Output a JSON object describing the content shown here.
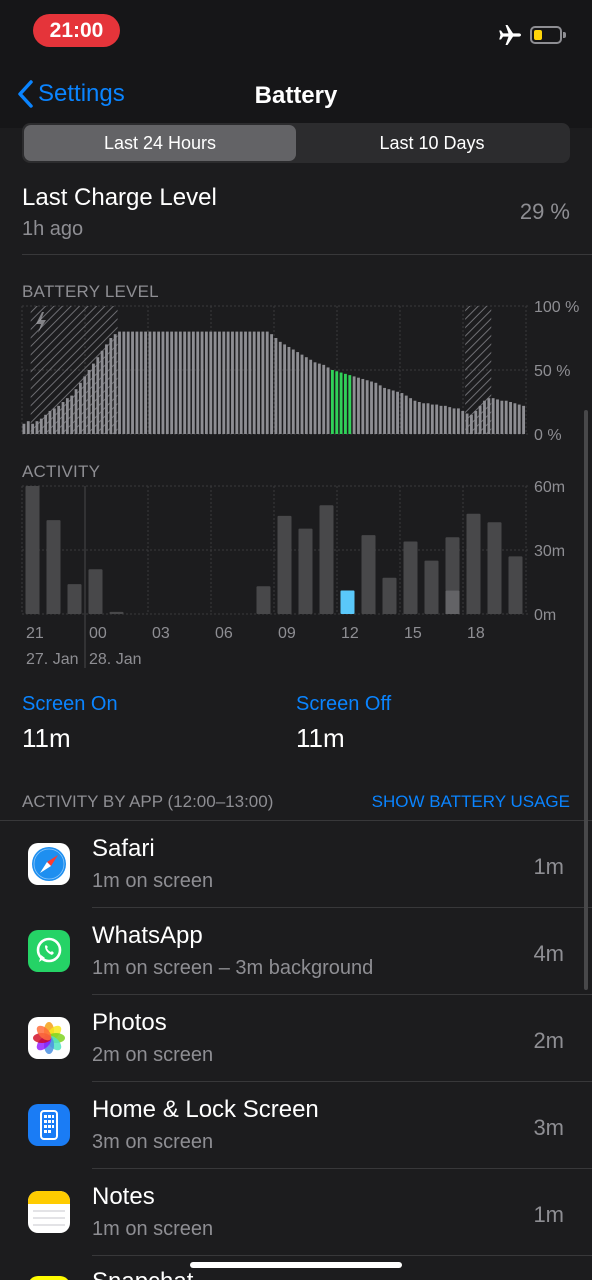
{
  "status": {
    "time": "21:00",
    "airplane_icon": "airplane-icon",
    "battery_icon": "battery-low-icon"
  },
  "nav": {
    "back_label": "Settings",
    "title": "Battery"
  },
  "segments": {
    "active": "Last 24 Hours",
    "inactive": "Last 10 Days"
  },
  "last_charge": {
    "title": "Last Charge Level",
    "sub": "1h ago",
    "value": "29 %"
  },
  "battery_level": {
    "label": "BATTERY LEVEL",
    "y_labels": [
      "100 %",
      "50 %",
      "0 %"
    ]
  },
  "activity": {
    "label": "ACTIVITY",
    "y_labels": [
      "60m",
      "30m",
      "0m"
    ],
    "x_labels": [
      "21",
      "00",
      "03",
      "06",
      "09",
      "12",
      "15",
      "18"
    ],
    "date_labels": [
      "27. Jan",
      "28. Jan"
    ]
  },
  "screen_on": {
    "label": "Screen On",
    "value": "11m"
  },
  "screen_off": {
    "label": "Screen Off",
    "value": "11m"
  },
  "activity_by_app": {
    "label": "ACTIVITY BY APP (12:00–13:00)",
    "link": "SHOW BATTERY USAGE"
  },
  "apps": [
    {
      "name": "Safari",
      "sub": "1m on screen",
      "time": "1m",
      "icon": "safari-icon"
    },
    {
      "name": "WhatsApp",
      "sub": "1m on screen – 3m background",
      "time": "4m",
      "icon": "whatsapp-icon"
    },
    {
      "name": "Photos",
      "sub": "2m on screen",
      "time": "2m",
      "icon": "photos-icon"
    },
    {
      "name": "Home & Lock Screen",
      "sub": "3m on screen",
      "time": "3m",
      "icon": "home-lock-screen-icon"
    },
    {
      "name": "Notes",
      "sub": "1m on screen",
      "time": "1m",
      "icon": "notes-icon"
    },
    {
      "name": "Snapchat",
      "icon": "snapchat-icon"
    }
  ],
  "colors": {
    "accent": "#0a84ff",
    "charging_green": "#30d158",
    "selected_blue": "#0a84ff",
    "selected_light": "#5ac8fa"
  },
  "chart_data": [
    {
      "type": "bar",
      "title": "BATTERY LEVEL",
      "ylim": [
        0,
        100
      ],
      "y_ticks": [
        "100 %",
        "50 %",
        "0 %"
      ],
      "values": [
        8,
        10,
        8,
        10,
        12,
        15,
        18,
        20,
        22,
        25,
        28,
        30,
        35,
        40,
        45,
        50,
        55,
        60,
        65,
        70,
        75,
        78,
        80,
        80,
        80,
        80,
        80,
        80,
        80,
        80,
        80,
        80,
        80,
        80,
        80,
        80,
        80,
        80,
        80,
        80,
        80,
        80,
        80,
        80,
        80,
        80,
        80,
        80,
        80,
        80,
        80,
        80,
        80,
        80,
        80,
        80,
        80,
        78,
        75,
        72,
        70,
        68,
        66,
        64,
        62,
        60,
        58,
        56,
        55,
        54,
        52,
        50,
        49,
        48,
        47,
        46,
        45,
        44,
        43,
        42,
        41,
        40,
        38,
        36,
        35,
        34,
        33,
        32,
        30,
        28,
        26,
        25,
        24,
        24,
        23,
        23,
        22,
        22,
        21,
        20,
        20,
        18,
        16,
        15,
        18,
        22,
        26,
        28,
        28,
        27,
        26,
        26,
        25,
        24,
        23,
        22
      ],
      "charging_ranges": [
        [
          2,
          22
        ],
        [
          102,
          108
        ]
      ],
      "highlight_range": [
        71,
        75
      ]
    },
    {
      "type": "bar",
      "title": "ACTIVITY",
      "ylim": [
        0,
        60
      ],
      "y_ticks": [
        "60m",
        "30m",
        "0m"
      ],
      "x_ticks": [
        "21",
        "00",
        "03",
        "06",
        "09",
        "12",
        "15",
        "18"
      ],
      "x_dates": [
        "27. Jan",
        "28. Jan"
      ],
      "series": [
        {
          "name": "Screen On",
          "values": [
            0,
            0,
            0,
            0,
            0,
            0,
            0,
            0,
            0,
            0,
            0,
            0,
            0,
            0,
            0,
            0,
            0,
            0,
            0,
            0,
            11,
            0,
            0,
            0
          ]
        },
        {
          "name": "Screen Off",
          "values": [
            60,
            44,
            14,
            21,
            1,
            0,
            0,
            0,
            0,
            0,
            0,
            13,
            46,
            40,
            51,
            11,
            37,
            17,
            34,
            25,
            25,
            47,
            43,
            27
          ]
        }
      ],
      "highlight_index": 15
    }
  ]
}
